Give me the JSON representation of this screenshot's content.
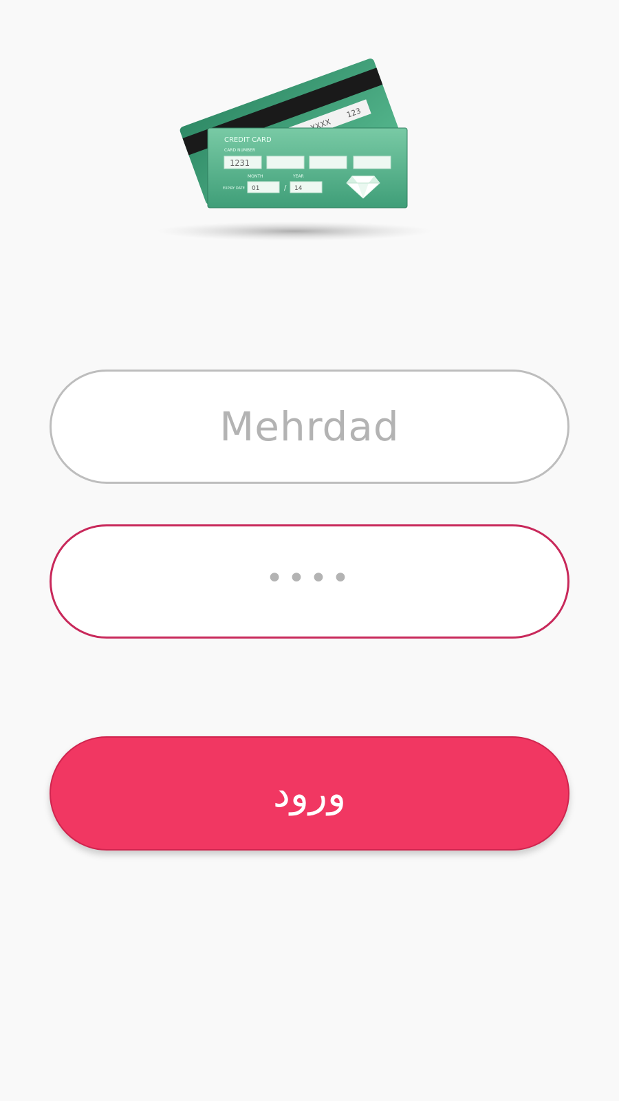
{
  "logo": {
    "icon": "credit-card-icon",
    "card_title": "CREDIT CARD",
    "card_number_label": "CARD NUMBER",
    "card_number_first": "1231",
    "back_code": "XXXX",
    "back_cvv": "123",
    "month_label": "MONTH",
    "year_label": "YEAR",
    "expiry_label": "EXPIRY DATE",
    "month_value": "01",
    "year_value": "14",
    "colors": {
      "card_green": "#3f9e78",
      "card_green_light": "#6cc49c",
      "stripe": "#1a1a1a"
    }
  },
  "form": {
    "username": {
      "value": "Mehrdad"
    },
    "password": {
      "masked_value": "••••"
    },
    "submit_label": "ورود"
  },
  "colors": {
    "background": "#f9f9f9",
    "accent": "#f13762",
    "password_border": "#c8285a",
    "username_border": "#bdbdbd"
  }
}
